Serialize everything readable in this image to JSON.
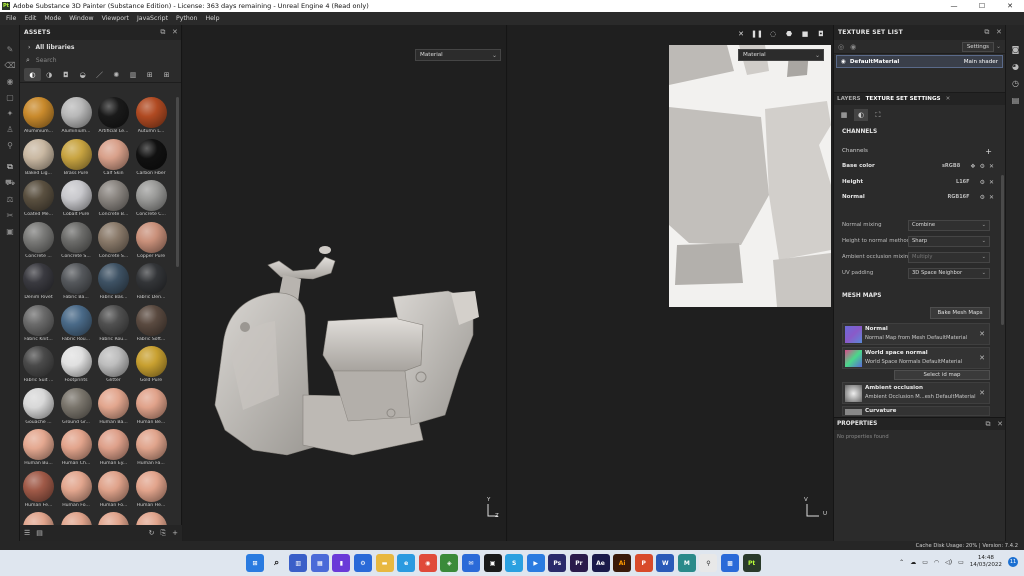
{
  "window": {
    "app_icon": "Pt",
    "title": "Adobe Substance 3D Painter (Substance Edition) - License: 363 days remaining - Unreal Engine 4 (Read only)"
  },
  "menu": [
    "File",
    "Edit",
    "Mode",
    "Window",
    "Viewport",
    "JavaScript",
    "Python",
    "Help"
  ],
  "assets": {
    "title": "ASSETS",
    "library": "All libraries",
    "search_placeholder": "Search",
    "items": [
      {
        "label": "Aluminium...",
        "color": "#c98a2c"
      },
      {
        "label": "Aluminium...",
        "color": "#b8b8b8"
      },
      {
        "label": "Artificial Le...",
        "color": "#1a1a1a"
      },
      {
        "label": "Autumn L...",
        "color": "#b04a22"
      },
      {
        "label": "Baked Lig...",
        "color": "#c9b8a2"
      },
      {
        "label": "Brass Pure",
        "color": "#c8a441"
      },
      {
        "label": "Calf Skin",
        "color": "#d8a08a"
      },
      {
        "label": "Carbon Fiber",
        "color": "#111111"
      },
      {
        "label": "Coated Me...",
        "color": "#5a5040"
      },
      {
        "label": "Cobalt Pure",
        "color": "#c8c8cc"
      },
      {
        "label": "Concrete B...",
        "color": "#8a8580"
      },
      {
        "label": "Concrete C...",
        "color": "#9a9a98"
      },
      {
        "label": "Concrete ...",
        "color": "#7a7a78"
      },
      {
        "label": "Concrete S...",
        "color": "#6c6c6a"
      },
      {
        "label": "Concrete S...",
        "color": "#8a7a6a"
      },
      {
        "label": "Copper Pure",
        "color": "#c9907a"
      },
      {
        "label": "Denim Rivet",
        "color": "#3a3a40"
      },
      {
        "label": "Fabric Ba...",
        "color": "#55585c"
      },
      {
        "label": "Fabric Bas...",
        "color": "#3e5264"
      },
      {
        "label": "Fabric Den...",
        "color": "#333538"
      },
      {
        "label": "Fabric Knit...",
        "color": "#6a6a6a"
      },
      {
        "label": "Fabric Rou...",
        "color": "#4a6a88"
      },
      {
        "label": "Fabric Rou...",
        "color": "#505050"
      },
      {
        "label": "Fabric Soft...",
        "color": "#5a4a40"
      },
      {
        "label": "Fabric Suit ...",
        "color": "#4a4a4a"
      },
      {
        "label": "Footprints",
        "color": "#e0e0e0"
      },
      {
        "label": "Glitter",
        "color": "#bdbdbd"
      },
      {
        "label": "Gold Pure",
        "color": "#c8a030"
      },
      {
        "label": "Gouache ...",
        "color": "#d8d8d8"
      },
      {
        "label": "Ground Gr...",
        "color": "#7a756c"
      },
      {
        "label": "Human Ba...",
        "color": "#e2a68e"
      },
      {
        "label": "Human Be...",
        "color": "#e0a28a"
      },
      {
        "label": "Human Bu...",
        "color": "#e4a890"
      },
      {
        "label": "Human Ch...",
        "color": "#e2a48c"
      },
      {
        "label": "Human Ey...",
        "color": "#dea08a"
      },
      {
        "label": "Human Fa...",
        "color": "#e0a48c"
      },
      {
        "label": "Human Fe...",
        "color": "#a05a48"
      },
      {
        "label": "Human Fo...",
        "color": "#e2a68e"
      },
      {
        "label": "Human Fo...",
        "color": "#dfa28a"
      },
      {
        "label": "Human He...",
        "color": "#e2a48c"
      },
      {
        "label": "",
        "color": "#e0a48c"
      },
      {
        "label": "",
        "color": "#e0a48c"
      },
      {
        "label": "",
        "color": "#e0a48c"
      },
      {
        "label": "",
        "color": "#e0a48c"
      }
    ]
  },
  "viewport3d": {
    "material_select": "Material",
    "axis_y": "Y",
    "axis_z": "Z"
  },
  "viewport2d": {
    "material_select": "Material",
    "axis_v": "V",
    "axis_u": "U"
  },
  "texture_set_list": {
    "title": "TEXTURE SET LIST",
    "settings_label": "Settings",
    "item_name": "DefaultMaterial",
    "item_shader": "Main shader"
  },
  "tabs": {
    "layers": "LAYERS",
    "texture_set_settings": "TEXTURE SET SETTINGS"
  },
  "channels": {
    "section": "CHANNELS",
    "label": "Channels",
    "items": [
      {
        "name": "Base color",
        "format": "sRGB8"
      },
      {
        "name": "Height",
        "format": "L16F"
      },
      {
        "name": "Normal",
        "format": "RGB16F"
      }
    ]
  },
  "settings_rows": [
    {
      "label": "Normal mixing",
      "value": "Combine",
      "disabled": false
    },
    {
      "label": "Height to normal method",
      "value": "Sharp",
      "disabled": false
    },
    {
      "label": "Ambient occlusion mixing",
      "value": "Multiply",
      "disabled": true
    },
    {
      "label": "UV padding",
      "value": "3D Space Neighbor",
      "disabled": false
    }
  ],
  "mesh_maps": {
    "section": "MESH MAPS",
    "bake_button": "Bake Mesh Maps",
    "select_id_button": "Select id map",
    "items": [
      {
        "name": "Normal",
        "desc": "Normal Map from Mesh DefaultMaterial"
      },
      {
        "name": "World space normal",
        "desc": "World Space Normals DefaultMaterial"
      },
      {
        "name": "Ambient occlusion",
        "desc": "Ambient Occlusion M...esh DefaultMaterial"
      },
      {
        "name": "Curvature",
        "desc": ""
      }
    ]
  },
  "properties": {
    "title": "PROPERTIES",
    "empty": "No properties found"
  },
  "statusbar": {
    "text": "Cache Disk Usage:   20% | Version: 7.4.2"
  },
  "taskbar": {
    "time": "14:48",
    "date": "14/03/2022",
    "notifications": "11"
  }
}
